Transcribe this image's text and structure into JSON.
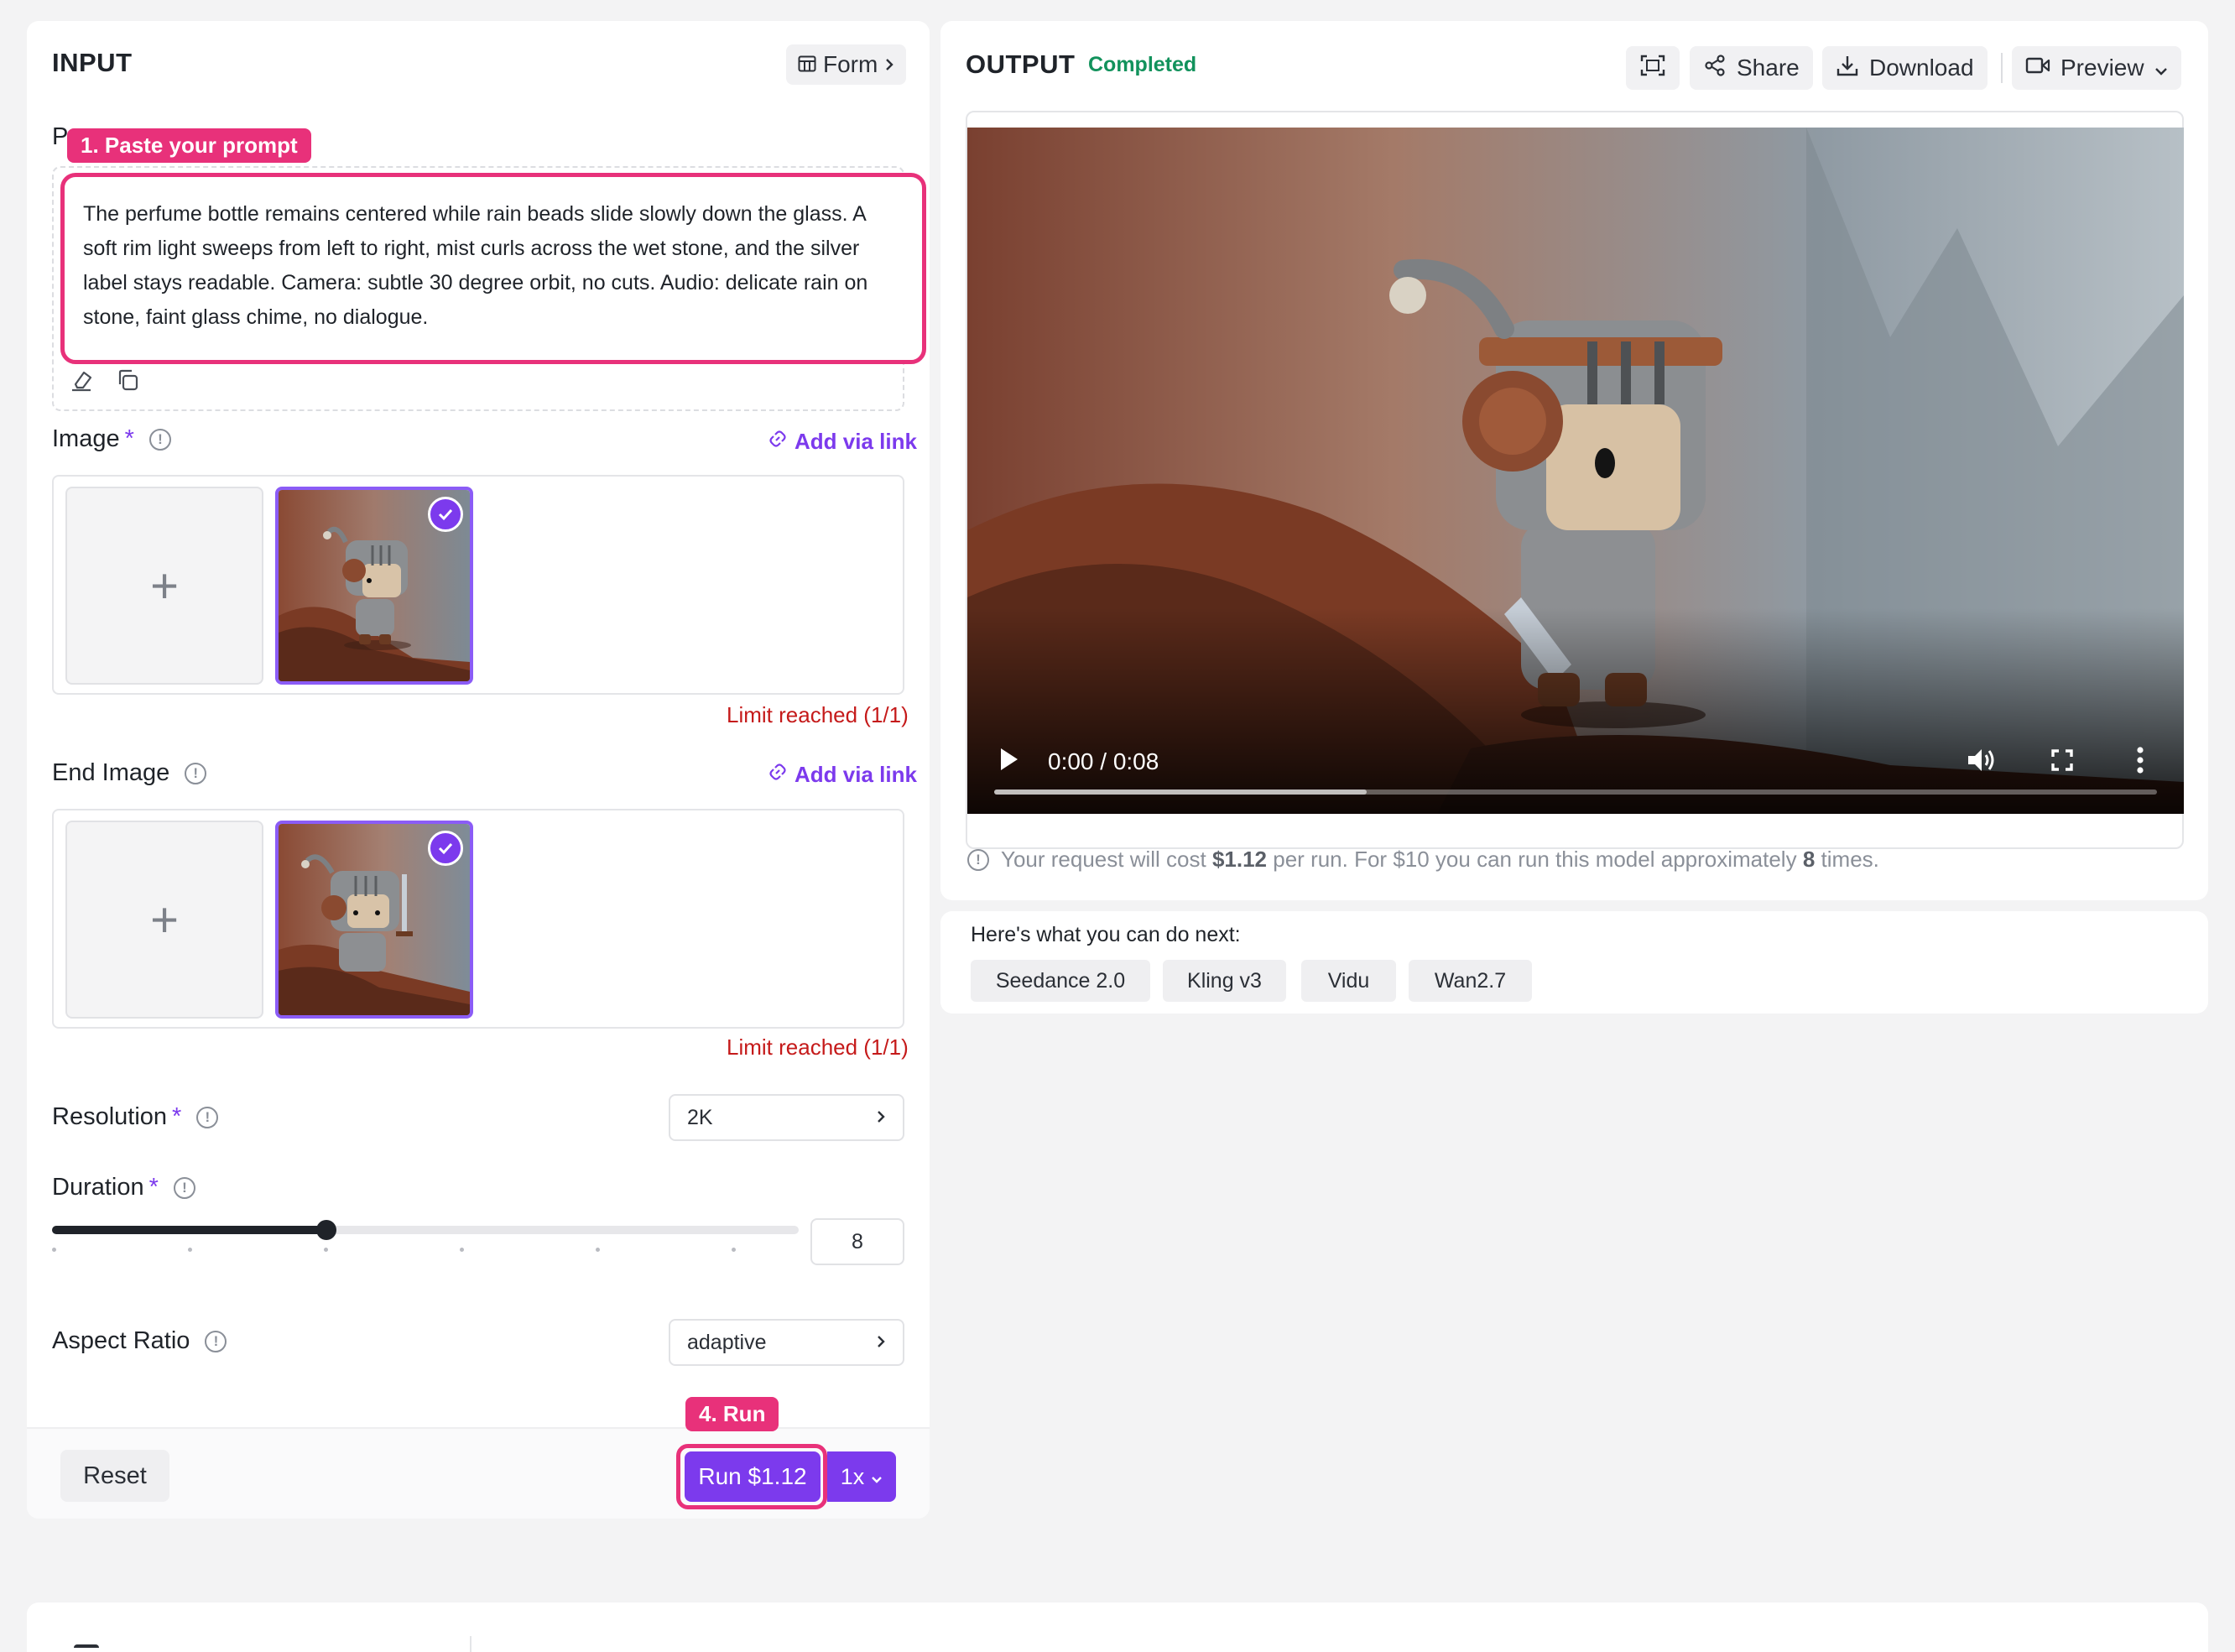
{
  "input": {
    "title": "INPUT",
    "form_button": "Form",
    "prompt_label_partial": "P",
    "hint_prompt": "1. Paste your prompt",
    "prompt_text": "The perfume bottle remains centered while rain beads slide slowly down the glass. A soft rim light sweeps from left to right, mist curls across the wet stone, and the silver label stays readable. Camera: subtle 30 degree orbit, no cuts. Audio: delicate rain on stone, faint glass chime, no dialogue.",
    "image": {
      "label": "Image",
      "required_mark": "*",
      "add_link": "Add via link",
      "limit": "Limit reached (1/1)",
      "add_tile": "+"
    },
    "end_image": {
      "label": "End Image",
      "add_link": "Add via link",
      "limit": "Limit reached (1/1)",
      "add_tile": "+"
    },
    "resolution": {
      "label": "Resolution",
      "required_mark": "*",
      "value": "2K"
    },
    "duration": {
      "label": "Duration",
      "required_mark": "*",
      "value": "8",
      "slider_fraction": 0.367
    },
    "aspect_ratio": {
      "label": "Aspect Ratio",
      "value": "adaptive"
    },
    "reset_button": "Reset",
    "hint_run": "4. Run",
    "run_button": "Run $1.12",
    "multiplier": "1x"
  },
  "output": {
    "title": "OUTPUT",
    "status": "Completed",
    "share_button": "Share",
    "download_button": "Download",
    "preview_button": "Preview",
    "video_time": "0:00 / 0:08",
    "video_progress_buffer": 0.32,
    "cost_prefix": "Your request will cost",
    "cost_amount": "$1.12",
    "cost_middle": "per run. For $10 you can run this model approximately",
    "cost_runs": "8",
    "cost_suffix": "times."
  },
  "next": {
    "title": "Here's what you can do next:",
    "chips": [
      "Seedance 2.0",
      "Kling v3",
      "Vidu",
      "Wan2.7"
    ]
  },
  "colors": {
    "accent": "#7c3aed",
    "highlight": "#e8317a",
    "status_green": "#12925c",
    "limit_red": "#c51a1a"
  },
  "icons": [
    "table-icon",
    "info-icon",
    "link-icon",
    "eraser-icon",
    "copy-icon",
    "check-icon",
    "chevron-right-icon",
    "chevron-down-icon",
    "fit-icon",
    "share-icon",
    "download-icon",
    "video-icon",
    "play-icon",
    "volume-icon",
    "fullscreen-icon",
    "more-icon"
  ]
}
